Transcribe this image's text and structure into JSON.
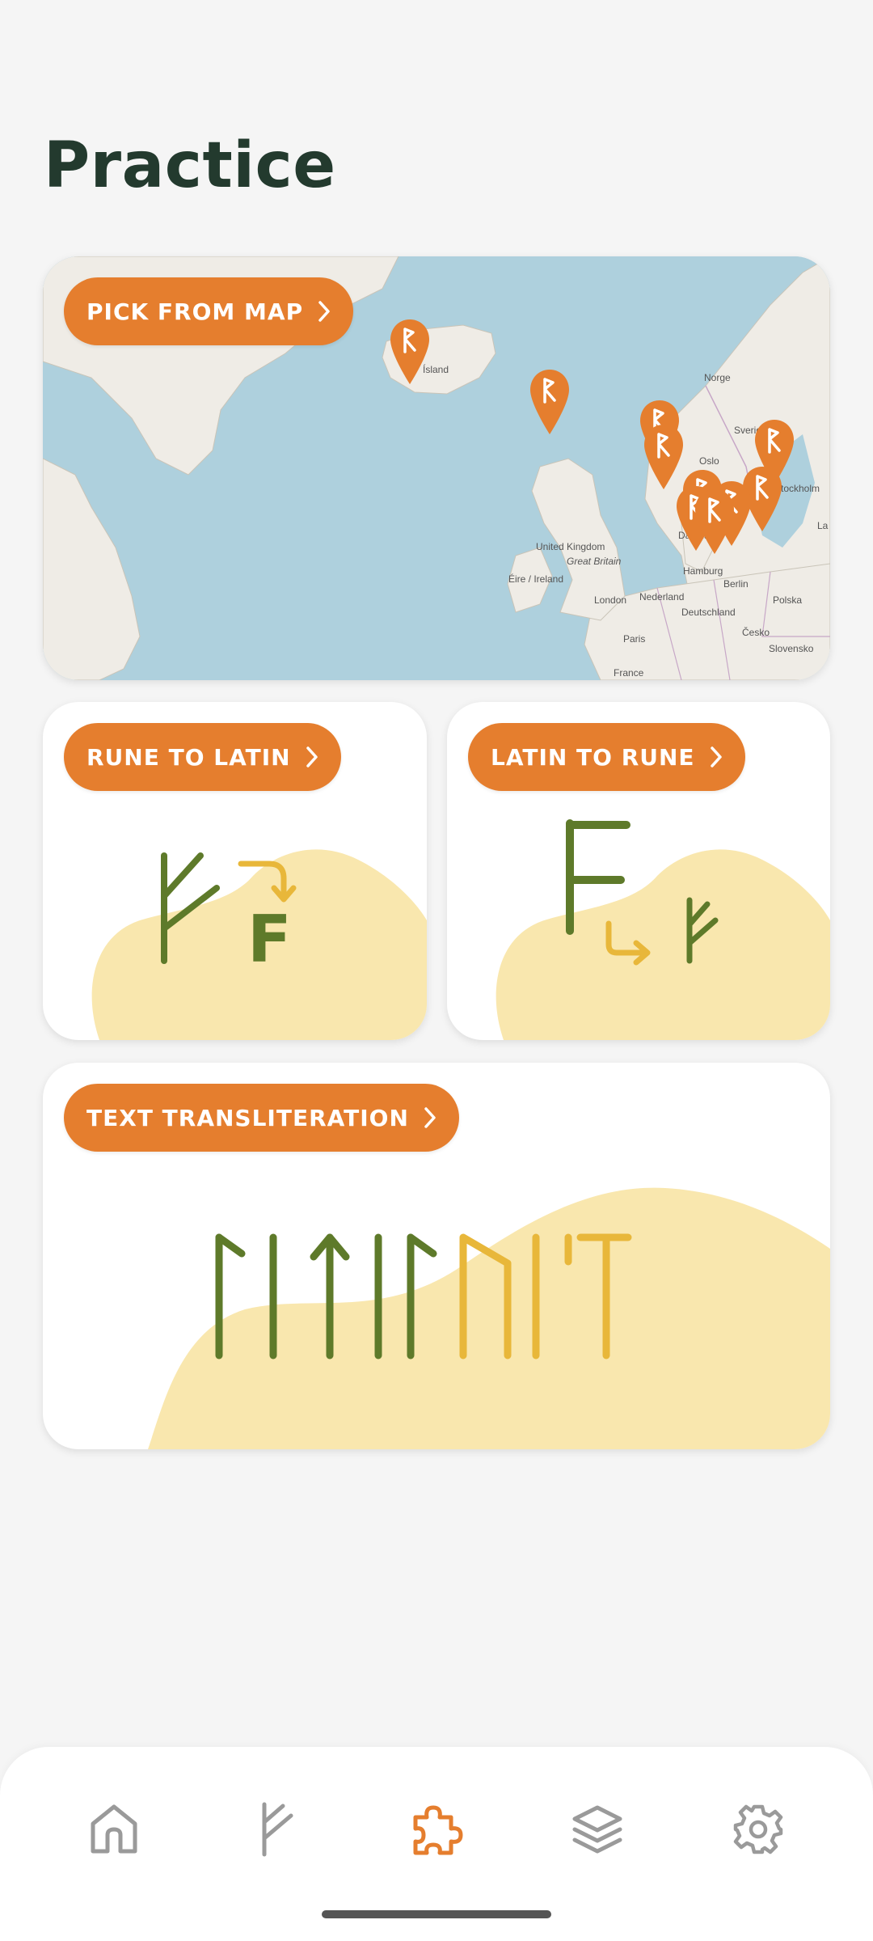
{
  "page": {
    "title": "Practice"
  },
  "cards": {
    "map": {
      "label": "PICK FROM MAP"
    },
    "rune_to_latin": {
      "label": "RUNE TO LATIN",
      "latin_letter": "F"
    },
    "latin_to_rune": {
      "label": "LATIN TO RUNE"
    },
    "text_transliteration": {
      "label": "TEXT TRANSLITERATION"
    }
  },
  "map_labels": [
    "Ísland",
    "Norge",
    "Sverige",
    "Oslo",
    "Stockholm",
    "United Kingdom",
    "Great Britain",
    "Éire / Ireland",
    "London",
    "Nederland",
    "Hamburg",
    "Berlin",
    "Deutschland",
    "Polska",
    "Paris",
    "Česko",
    "France",
    "Slovensko",
    "Danmark",
    "La"
  ],
  "bottom_nav": {
    "items": [
      {
        "id": "home",
        "icon": "home-icon",
        "active": false
      },
      {
        "id": "runes",
        "icon": "rune-icon",
        "active": false
      },
      {
        "id": "practice",
        "icon": "puzzle-icon",
        "active": true
      },
      {
        "id": "learn",
        "icon": "layers-icon",
        "active": false
      },
      {
        "id": "settings",
        "icon": "gear-icon",
        "active": false
      }
    ]
  },
  "colors": {
    "accent": "#e57e2e",
    "rune_green": "#5e7a2a",
    "rune_yellow": "#e8b73a",
    "blob": "#f9e7ae",
    "title": "#233a2e",
    "nav_inactive": "#9a9a9a",
    "water": "#aed0dd",
    "land": "#efece6"
  }
}
